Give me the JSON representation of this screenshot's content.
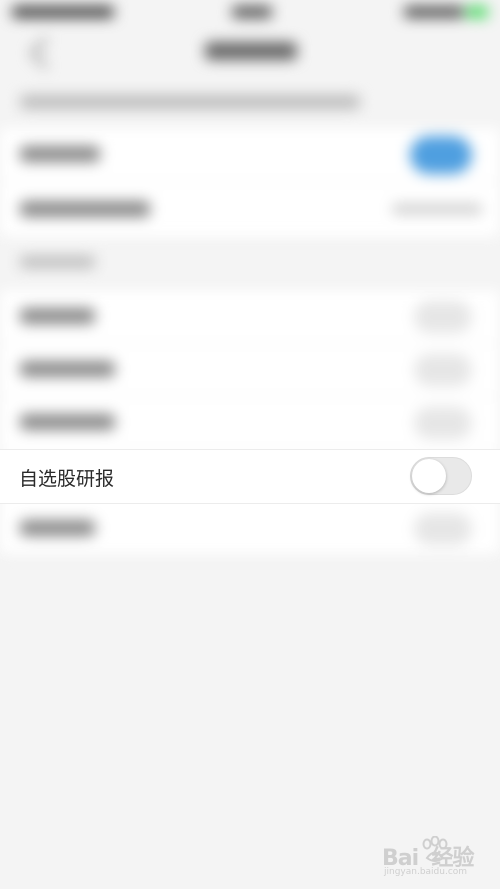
{
  "setting": {
    "label": "自选股研报",
    "enabled": false
  },
  "watermark": {
    "brand": "Bai  经验",
    "url": "jingyan.baidu.com"
  }
}
